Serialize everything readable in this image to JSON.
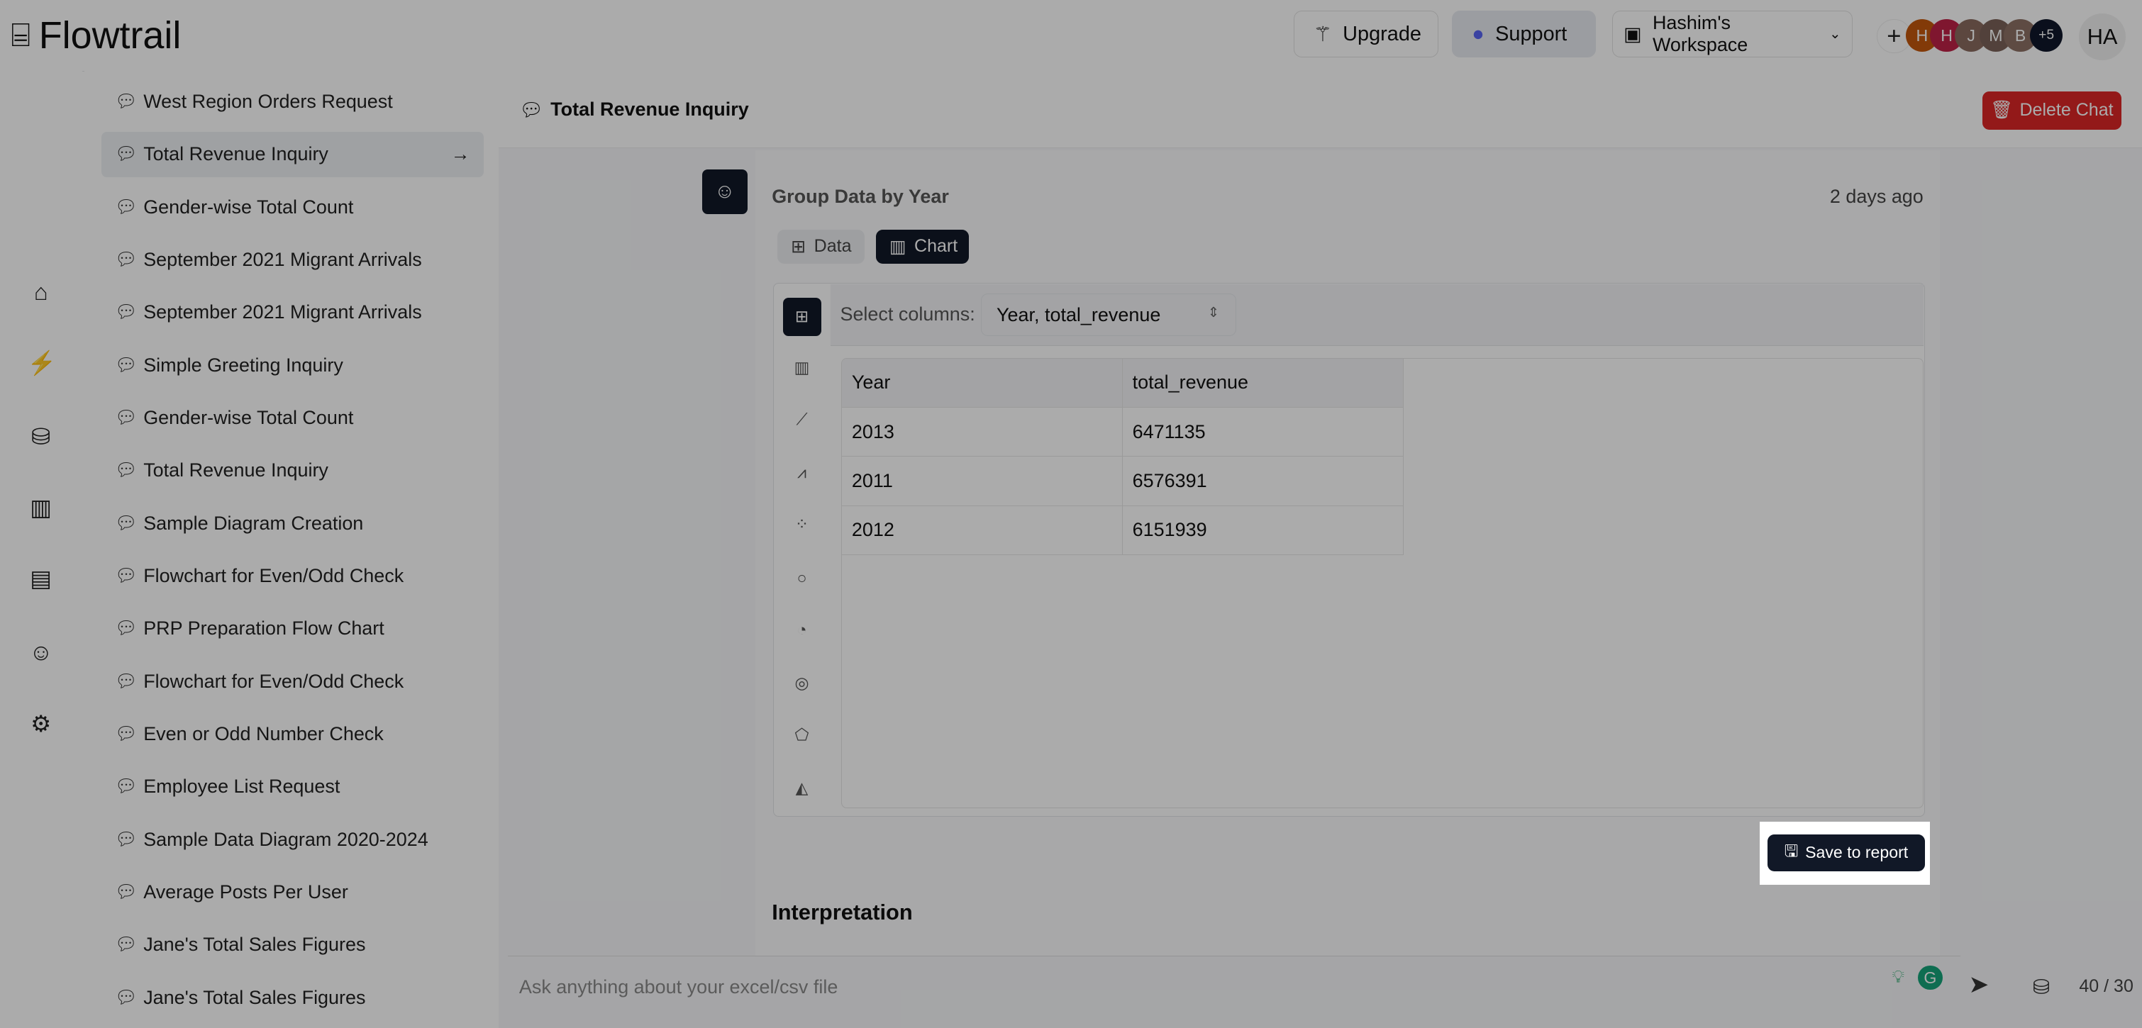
{
  "header": {
    "logo": "Flowtrail",
    "upgrade": "Upgrade",
    "support": "Support",
    "workspace": "Hashim's Workspace",
    "add": "+",
    "members": [
      {
        "initial": "H",
        "color": "#c2570c"
      },
      {
        "initial": "H",
        "color": "#be2146"
      },
      {
        "initial": "J",
        "color": "#8a6b5f"
      },
      {
        "initial": "M",
        "color": "#7b6258"
      },
      {
        "initial": "B",
        "color": "#8c7164"
      }
    ],
    "more": "+5",
    "user": "HA"
  },
  "sidebar": {
    "items": [
      "West Region Orders Request",
      "Total Revenue Inquiry",
      "Gender-wise Total Count",
      "September 2021 Migrant Arrivals",
      "September 2021 Migrant Arrivals",
      "Simple Greeting Inquiry",
      "Gender-wise Total Count",
      "Total Revenue Inquiry",
      "Sample Diagram Creation",
      "Flowchart for Even/Odd Check",
      "PRP Preparation Flow Chart",
      "Flowchart for Even/Odd Check",
      "Even or Odd Number Check",
      "Employee List Request",
      "Sample Data Diagram 2020-2024",
      "Average Posts Per User",
      "Jane's Total Sales Figures",
      "Jane's Total Sales Figures"
    ],
    "active_index": 1
  },
  "chat": {
    "title": "Total Revenue Inquiry",
    "delete": "Delete Chat"
  },
  "message": {
    "title": "Group Data by Year",
    "time": "2 days ago",
    "tabs": {
      "data": "Data",
      "chart": "Chart"
    },
    "active_tab": "Chart",
    "select_label": "Select columns:",
    "select_value": "Year, total_revenue",
    "table": {
      "columns": [
        "Year",
        "total_revenue"
      ],
      "rows": [
        [
          "2013",
          "6471135"
        ],
        [
          "2011",
          "6576391"
        ],
        [
          "2012",
          "6151939"
        ]
      ]
    },
    "save": "Save to report",
    "interpretation": "Interpretation"
  },
  "input": {
    "placeholder": "Ask anything about your excel/csv file",
    "count": "40 / 30"
  },
  "colors": {
    "primary": "#111827",
    "danger": "#dc2626",
    "discord": "#5865f2"
  }
}
